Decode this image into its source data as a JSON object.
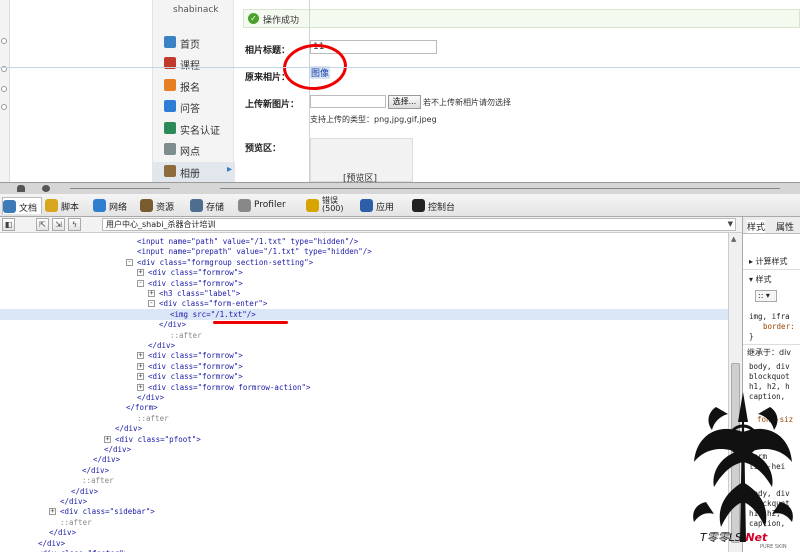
{
  "page": {
    "sidebar": {
      "username": "shabinack",
      "items": [
        {
          "label": "首页",
          "icon": "home-icon",
          "color": "#3b82c4"
        },
        {
          "label": "课程",
          "icon": "course-icon",
          "color": "#c0392b"
        },
        {
          "label": "报名",
          "icon": "signup-icon",
          "color": "#e67e22"
        },
        {
          "label": "问答",
          "icon": "question-icon",
          "color": "#2e7dd7"
        },
        {
          "label": "实名认证",
          "icon": "id-card-icon",
          "color": "#2c8a5a"
        },
        {
          "label": "网点",
          "icon": "outlet-icon",
          "color": "#7f8c8d"
        },
        {
          "label": "相册",
          "icon": "album-icon",
          "color": "#8e6b3d"
        }
      ]
    },
    "success_message": "操作成功",
    "form": {
      "title_label": "相片标题：",
      "title_value": "11",
      "original_label": "原来相片：",
      "original_link": "图像",
      "upload_label": "上传新图片：",
      "browse_button": "选择...",
      "upload_hint": "若不上传新相片请勿选择",
      "allowed_types": "支持上传的类型：png,jpg,gif,jpeg",
      "preview_label": "预览区：",
      "preview_placeholder": "[预览区]"
    }
  },
  "devtools": {
    "tabs": [
      {
        "label": "文档",
        "icon": "document-icon",
        "color": "#3d7ab8"
      },
      {
        "label": "脚本",
        "icon": "script-icon",
        "color": "#d9a51c"
      },
      {
        "label": "网络",
        "icon": "network-icon",
        "color": "#2f7fd1"
      },
      {
        "label": "资源",
        "icon": "resources-icon",
        "color": "#7a5a2f"
      },
      {
        "label": "存储",
        "icon": "storage-icon",
        "color": "#4f6d8f"
      },
      {
        "label": "Profiler",
        "icon": "profiler-icon",
        "color": "#888888"
      },
      {
        "label": "错误",
        "sub": "(500)",
        "icon": "error-icon",
        "color": "#d8a400"
      },
      {
        "label": "应用",
        "icon": "app-icon",
        "color": "#2d5fa8"
      },
      {
        "label": "控制台",
        "icon": "console-icon",
        "color": "#222222"
      }
    ],
    "breadcrumb": "用户中心_shabi_杀器合计培训",
    "dom_lines": [
      {
        "text": "<input name=\"path\" value=\"/1.txt\" type=\"hidden\"/>"
      },
      {
        "text": "<input name=\"prepath\" value=\"/1.txt\" type=\"hidden\"/>"
      },
      {
        "text": "<div class=\"formgroup section-setting\">"
      },
      {
        "text": "<div class=\"formrow\">"
      },
      {
        "text": "<div class=\"formrow\">"
      },
      {
        "text": "<h3 class=\"label\">"
      },
      {
        "text": "<div class=\"form-enter\">"
      },
      {
        "text": "<img src=\"/1.txt\"/>"
      },
      {
        "text": "</div>"
      },
      {
        "text": "::after"
      },
      {
        "text": "</div>"
      },
      {
        "text": "<div class=\"formrow\">"
      },
      {
        "text": "<div class=\"formrow\">"
      },
      {
        "text": "<div class=\"formrow\">"
      },
      {
        "text": "<div class=\"formrow formrow-action\">"
      },
      {
        "text": "</div>"
      },
      {
        "text": "</form>"
      },
      {
        "text": "::after"
      },
      {
        "text": "</div>"
      },
      {
        "text": "<div class=\"pfoot\">"
      },
      {
        "text": "</div>"
      },
      {
        "text": "</div>"
      },
      {
        "text": "</div>"
      },
      {
        "text": "::after"
      },
      {
        "text": "</div>"
      },
      {
        "text": "</div>"
      },
      {
        "text": "<div class=\"sidebar\">"
      },
      {
        "text": "::after"
      },
      {
        "text": "</div>"
      },
      {
        "text": "</div>"
      },
      {
        "text": "<div class=\"footer\">"
      }
    ],
    "styles_panel": {
      "tabs": [
        "样式",
        "属性"
      ],
      "computed": "▸ 计算样式",
      "styles_header": "▾ 样式",
      "dropdown": ":: ▾",
      "rule1_selector": "img, ifra",
      "rule1_prop": "border:",
      "rule1_close": "}",
      "inherit_label": "继承于：div",
      "rule2": [
        "body, div",
        "blockquot",
        "h1, h2, h",
        "caption, "
      ],
      "rule2_prop": "font-siz",
      "rule3": [
        "div",
        "form",
        "line-hei"
      ],
      "rule4": [
        "body, div",
        "blockquot",
        "h1, h2, h",
        "caption, "
      ]
    }
  },
  "watermark": {
    "text_prefix": "T零零",
    "text_mid": "LS.",
    "text_suffix": "Net",
    "sub": "PURE SKIN"
  }
}
